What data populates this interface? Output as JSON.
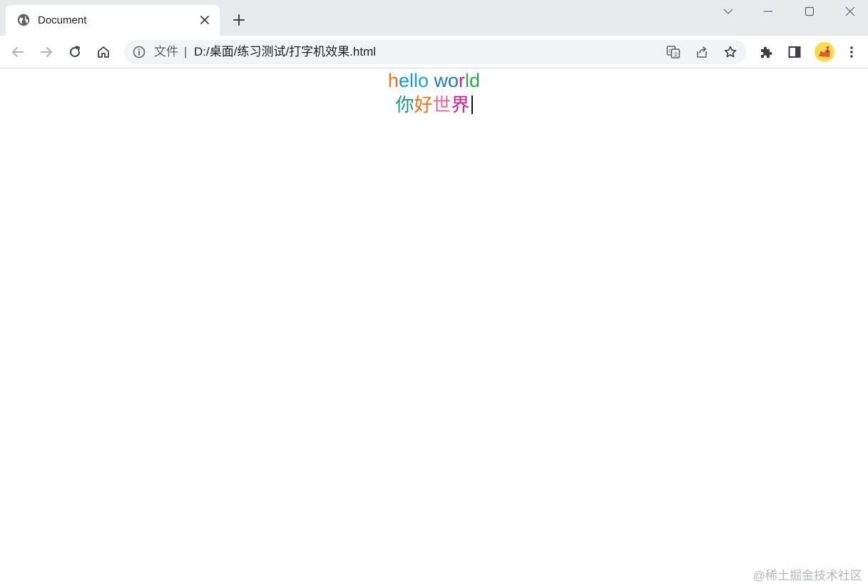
{
  "tab": {
    "title": "Document",
    "favicon": "globe-icon"
  },
  "window_controls": [
    "chevron-down-icon",
    "minimize-icon",
    "maximize-icon",
    "close-icon"
  ],
  "toolbar": {
    "back": "back-arrow-icon",
    "forward": "forward-arrow-icon",
    "reload": "reload-icon",
    "home": "home-icon"
  },
  "omnibox": {
    "scheme_label": "文件",
    "separator": "|",
    "url": "D:/桌面/练习测试/打字机效果.html",
    "actions": [
      "translate-icon",
      "share-icon",
      "star-icon"
    ]
  },
  "extensions": [
    "puzzle-icon",
    "side-panel-icon",
    "avatar",
    "more-vert-icon"
  ],
  "page": {
    "line1": [
      {
        "ch": "h",
        "color": "#e8711a"
      },
      {
        "ch": "e",
        "color": "#17a2b8"
      },
      {
        "ch": "l",
        "color": "#1f9bd6"
      },
      {
        "ch": "l",
        "color": "#1f9bd6"
      },
      {
        "ch": "o",
        "color": "#1ba7c9"
      },
      {
        "ch": " ",
        "color": "#000000"
      },
      {
        "ch": "w",
        "color": "#1f7db0"
      },
      {
        "ch": "o",
        "color": "#1f7db0"
      },
      {
        "ch": "r",
        "color": "#d81b7e"
      },
      {
        "ch": "l",
        "color": "#2aa84a"
      },
      {
        "ch": "d",
        "color": "#2aa84a"
      }
    ],
    "line2": [
      {
        "ch": "你",
        "color": "#1f9a78"
      },
      {
        "ch": "好",
        "color": "#e8711a"
      },
      {
        "ch": "世",
        "color": "#e56a9a"
      },
      {
        "ch": "界",
        "color": "#d0178a"
      }
    ]
  },
  "watermark": "@稀土掘金技术社区"
}
